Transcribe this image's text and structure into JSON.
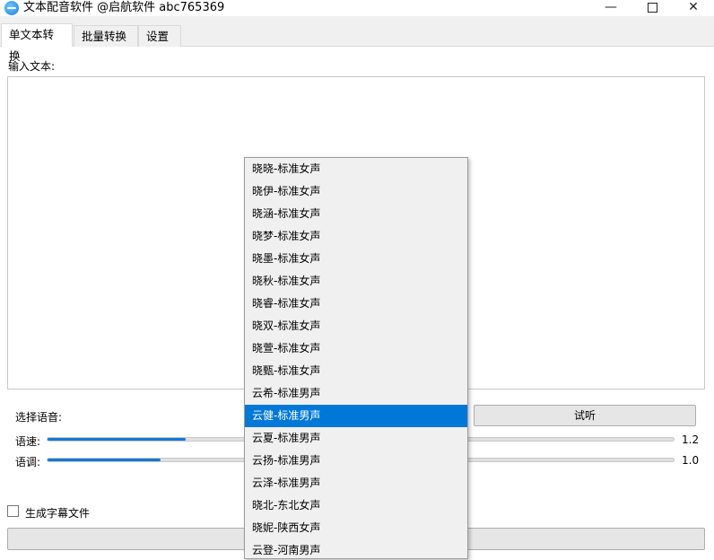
{
  "window": {
    "title": "文本配音软件 @启航软件 abc765369",
    "minimize": "—",
    "close": "✕"
  },
  "tabs": [
    {
      "label": "单文本转换",
      "active": true
    },
    {
      "label": "批量转换",
      "active": false
    },
    {
      "label": "设置",
      "active": false
    }
  ],
  "main": {
    "input_label": "输入文本:",
    "input_value": "",
    "voice_label": "选择语音:",
    "listen_button": "试听",
    "speed_label": "语速:",
    "speed_value": "1.2",
    "speed_fraction": 0.22,
    "pitch_label": "语调:",
    "pitch_value": "1.0",
    "pitch_fraction": 0.18,
    "subtitle_checkbox_label": "生成字幕文件",
    "subtitle_checked": false,
    "convert_button": ""
  },
  "voice_dropdown": {
    "selected_index": 11,
    "options": [
      "晓晓-标准女声",
      "晓伊-标准女声",
      "晓涵-标准女声",
      "晓梦-标准女声",
      "晓墨-标准女声",
      "晓秋-标准女声",
      "晓睿-标准女声",
      "晓双-标准女声",
      "晓萱-标准女声",
      "晓甄-标准女声",
      "云希-标准男声",
      "云健-标准男声",
      "云夏-标准男声",
      "云扬-标准男声",
      "云泽-标准男声",
      "晓北-东北女声",
      "晓妮-陕西女声",
      "云登-河南男声"
    ]
  },
  "colors": {
    "accent": "#0078d7",
    "slider_fill": "#1478d4",
    "window_bg": "#f0f0f0"
  }
}
